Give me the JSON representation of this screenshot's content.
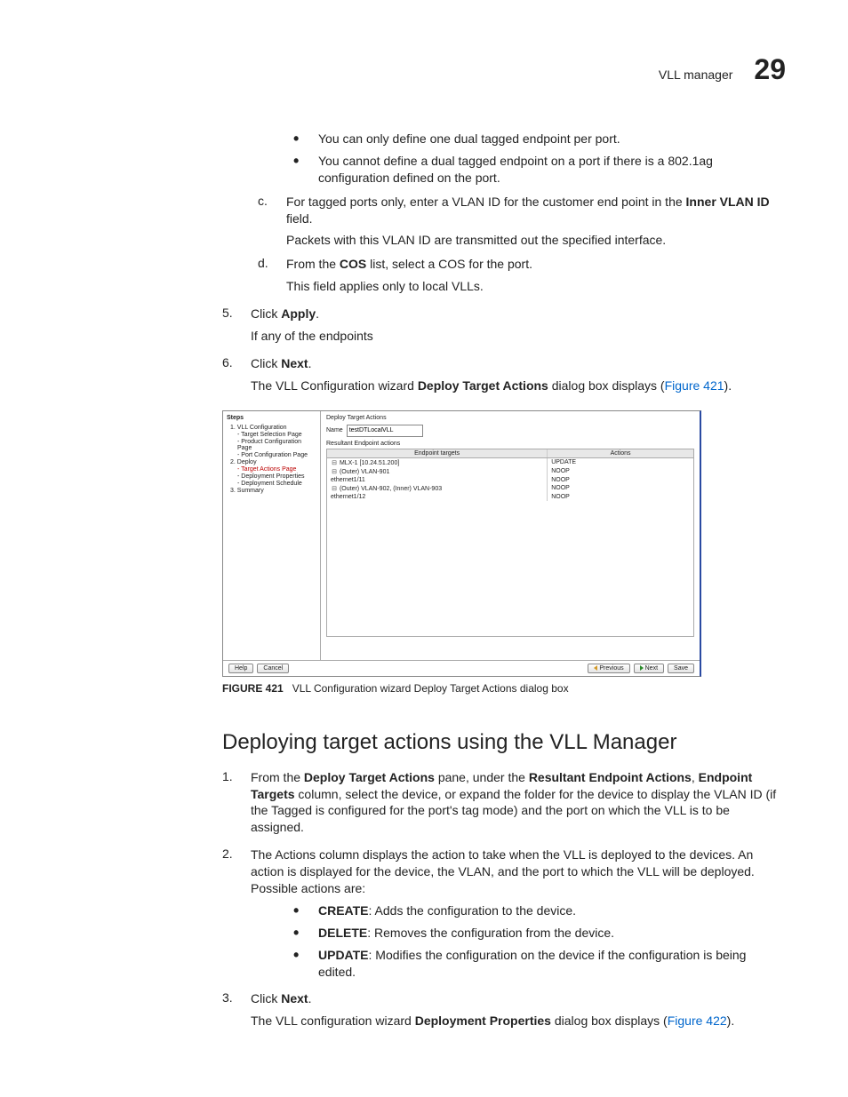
{
  "header": {
    "title": "VLL manager",
    "chapter": "29"
  },
  "bullets": {
    "b1": "You can only define one dual tagged endpoint per port.",
    "b2": "You cannot define a dual tagged endpoint on a port if there is a 802.1ag configuration defined on the port."
  },
  "step_c": {
    "marker": "c.",
    "text_before": "For tagged ports only, enter a VLAN ID for the customer end point in the ",
    "bold": "Inner VLAN ID",
    "text_after": " field.",
    "sub": "Packets with this VLAN ID are transmitted out the specified interface."
  },
  "step_d": {
    "marker": "d.",
    "text_before": "From the ",
    "bold": "COS",
    "text_after": " list, select a COS for the port.",
    "sub": "This field applies only to local VLLs."
  },
  "step5": {
    "marker": "5.",
    "text_before": "Click ",
    "bold": "Apply",
    "text_after": ".",
    "sub": "If any of the endpoints"
  },
  "step6": {
    "marker": "6.",
    "text_before": "Click ",
    "bold": "Next",
    "text_after": ".",
    "sub_a": "The VLL Configuration wizard ",
    "sub_bold": "Deploy Target Actions",
    "sub_b": " dialog box displays (",
    "figref": "Figure 421",
    "sub_c": ")."
  },
  "dialog": {
    "steps_title": "Steps",
    "steps": {
      "s1": "1. VLL Configuration",
      "s1a": "- Target Selection Page",
      "s1b": "- Product Configuration Page",
      "s1c": "- Port Configuration Page",
      "s2": "2. Deploy",
      "s2a": "- Target Actions Page",
      "s2b": "- Deployment Properties",
      "s2c": "- Deployment Schedule",
      "s3": "3. Summary"
    },
    "main_title": "Deploy Target Actions",
    "name_label": "Name",
    "name_value": "testDTLocalVLL",
    "sub_title": "Resultant Endpoint actions",
    "col1": "Endpoint targets",
    "col2": "Actions",
    "rows": [
      {
        "c1": "MLX-1 [10.24.51.200]",
        "c2": "UPDATE",
        "indent": 0,
        "icon": "⊟"
      },
      {
        "c1": "(Outer) VLAN-901",
        "c2": "NOOP",
        "indent": 1,
        "icon": "⊟"
      },
      {
        "c1": "ethernet1/11",
        "c2": "NOOP",
        "indent": 2,
        "icon": ""
      },
      {
        "c1": "(Outer) VLAN-902, (Inner) VLAN-903",
        "c2": "NOOP",
        "indent": 1,
        "icon": "⊟"
      },
      {
        "c1": "ethernet1/12",
        "c2": "NOOP",
        "indent": 2,
        "icon": ""
      }
    ],
    "buttons": {
      "help": "Help",
      "cancel": "Cancel",
      "prev": "Previous",
      "next": "Next",
      "save": "Save"
    }
  },
  "figcap": {
    "label": "FIGURE 421",
    "text": "VLL Configuration wizard Deploy Target Actions dialog box"
  },
  "section_heading": "Deploying target actions using the VLL Manager",
  "dstep1": {
    "marker": "1.",
    "a": "From the ",
    "b1": "Deploy Target Actions",
    "c": " pane, under the ",
    "b2": "Resultant Endpoint Actions",
    "d": ", ",
    "b3": "Endpoint Targets",
    "e": " column, select the device, or expand the folder for the device to display the VLAN ID (if the Tagged is configured for the port's tag mode) and the port on which the VLL is to be assigned."
  },
  "dstep2": {
    "marker": "2.",
    "text": "The Actions column displays the action to take when the VLL is deployed to the devices. An action is displayed for the device, the VLAN, and the port to which the VLL will be deployed. Possible actions are:",
    "b1_label": "CREATE",
    "b1_text": ": Adds the configuration to the device.",
    "b2_label": "DELETE",
    "b2_text": ": Removes the configuration from the device.",
    "b3_label": "UPDATE",
    "b3_text": ": Modifies the configuration on the device if the configuration is being edited."
  },
  "dstep3": {
    "marker": "3.",
    "text_before": "Click ",
    "bold": "Next",
    "text_after": ".",
    "sub_a": "The VLL configuration wizard ",
    "sub_bold": "Deployment Properties",
    "sub_b": " dialog box displays (",
    "figref": "Figure 422",
    "sub_c": ")."
  }
}
